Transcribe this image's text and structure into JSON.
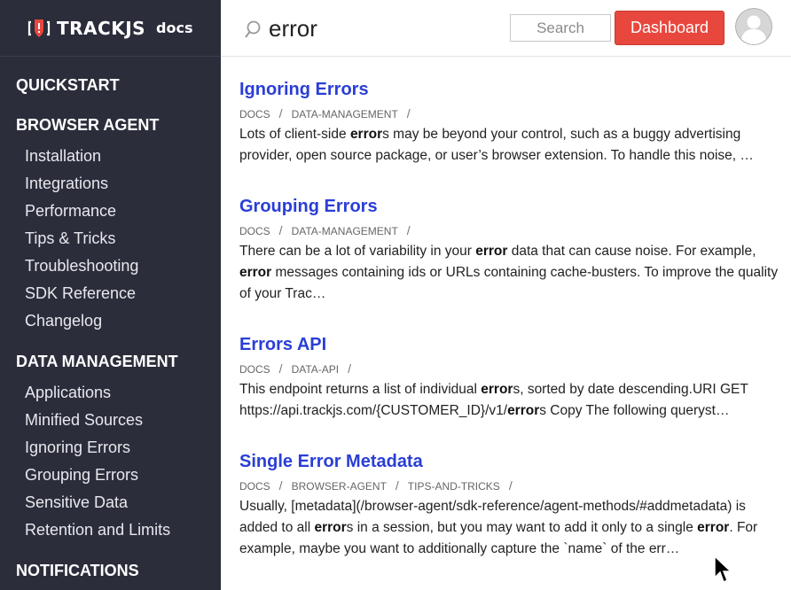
{
  "brand": {
    "name": "TRACKJS",
    "sub": "docs"
  },
  "search": {
    "query": "error",
    "button_label": "Search"
  },
  "header": {
    "dashboard_label": "Dashboard"
  },
  "sidebar": {
    "sections": [
      {
        "label": "QUICKSTART",
        "items": []
      },
      {
        "label": "BROWSER AGENT",
        "items": [
          "Installation",
          "Integrations",
          "Performance",
          "Tips & Tricks",
          "Troubleshooting",
          "SDK Reference",
          "Changelog"
        ]
      },
      {
        "label": "DATA MANAGEMENT",
        "items": [
          "Applications",
          "Minified Sources",
          "Ignoring Errors",
          "Grouping Errors",
          "Sensitive Data",
          "Retention and Limits"
        ]
      },
      {
        "label": "NOTIFICATIONS",
        "items": []
      }
    ]
  },
  "results": [
    {
      "title": "Ignoring Errors",
      "crumbs": [
        "DOCS",
        "DATA-MANAGEMENT"
      ],
      "lines": [
        [
          [
            "Lots of client-side ",
            false
          ],
          [
            "error",
            true
          ],
          [
            "s may be beyond your control, such as a buggy advertising",
            false
          ]
        ],
        [
          [
            "provider, open source package, or user’s browser extension. To handle this noise, …",
            false
          ]
        ]
      ]
    },
    {
      "title": "Grouping Errors",
      "crumbs": [
        "DOCS",
        "DATA-MANAGEMENT"
      ],
      "lines": [
        [
          [
            "There can be a lot of variability in your ",
            false
          ],
          [
            "error",
            true
          ],
          [
            " data that can cause noise. For example,",
            false
          ]
        ],
        [
          [
            "error",
            true
          ],
          [
            " messages containing ids or URLs containing cache-busters. To improve the quality",
            false
          ]
        ],
        [
          [
            "of your Trac…",
            false
          ]
        ]
      ]
    },
    {
      "title": "Errors API",
      "crumbs": [
        "DOCS",
        "DATA-API"
      ],
      "lines": [
        [
          [
            "This endpoint returns a list of individual ",
            false
          ],
          [
            "error",
            true
          ],
          [
            "s, sorted by date descending.URI GET",
            false
          ]
        ],
        [
          [
            "https://api.trackjs.com/{CUSTOMER_ID}/v1/",
            false
          ],
          [
            "error",
            true
          ],
          [
            "s Copy The following queryst…",
            false
          ]
        ]
      ]
    },
    {
      "title": "Single Error Metadata",
      "crumbs": [
        "DOCS",
        "BROWSER-AGENT",
        "TIPS-AND-TRICKS"
      ],
      "lines": [
        [
          [
            "Usually, [metadata](/browser-agent/sdk-reference/agent-methods/#addmetadata) is",
            false
          ]
        ],
        [
          [
            "added to all ",
            false
          ],
          [
            "error",
            true
          ],
          [
            "s in a session, but you may want to add it only to a single ",
            false
          ],
          [
            "error",
            true
          ],
          [
            ". For",
            false
          ]
        ],
        [
          [
            "example, maybe you want to additionally capture the `name` of the err…",
            false
          ]
        ]
      ]
    }
  ]
}
